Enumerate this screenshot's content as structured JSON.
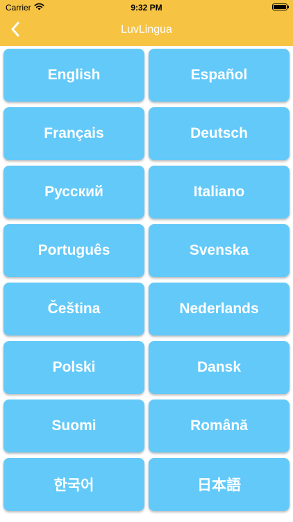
{
  "status_bar": {
    "carrier": "Carrier",
    "time": "9:32 PM",
    "wifi_icon": "wifi-icon",
    "battery_icon": "battery-full-icon"
  },
  "nav_bar": {
    "title": "LuvLingua",
    "back_icon": "chevron-left-icon"
  },
  "colors": {
    "bar_background": "#f6c343",
    "button_background": "#63c9f9",
    "button_text": "#ffffff"
  },
  "languages": [
    "English",
    "Español",
    "Français",
    "Deutsch",
    "Русский",
    "Italiano",
    "Português",
    "Svenska",
    "Čeština",
    "Nederlands",
    "Polski",
    "Dansk",
    "Suomi",
    "Română",
    "한국어",
    "日本語"
  ]
}
